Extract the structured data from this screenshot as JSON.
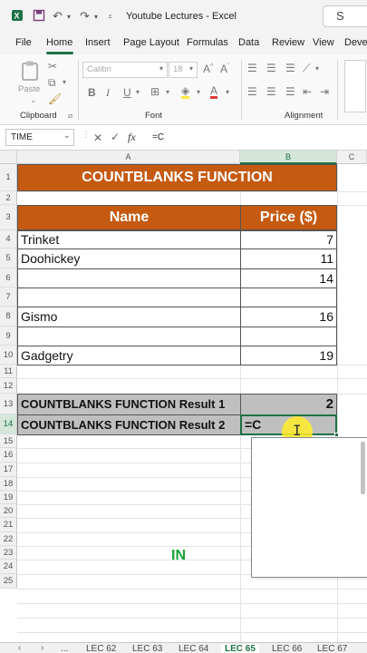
{
  "window": {
    "title": "Youtube Lectures - Excel",
    "search_glyph": "S"
  },
  "menu": {
    "items": [
      "File",
      "Home",
      "Insert",
      "Page Layout",
      "Formulas",
      "Data",
      "Review",
      "View",
      "Devel"
    ],
    "active": "Home"
  },
  "ribbon": {
    "paste_label": "Paste",
    "font_name": "Calibri",
    "font_size": "18",
    "groups": {
      "clipboard": "Clipboard",
      "font": "Font",
      "alignment": "Alignment"
    }
  },
  "formula_bar": {
    "name_box": "TIME",
    "fx_label": "fx",
    "content": "=C"
  },
  "columns": [
    "A",
    "B",
    "C"
  ],
  "active_column": "B",
  "rows": [
    "1",
    "2",
    "3",
    "4",
    "5",
    "6",
    "7",
    "8",
    "9",
    "10",
    "11",
    "12",
    "13",
    "14",
    "15",
    "16",
    "17",
    "18",
    "19",
    "20",
    "21",
    "22",
    "23",
    "24",
    "25"
  ],
  "active_row": "14",
  "sheet": {
    "title": "COUNTBLANKS FUNCTION",
    "headers": {
      "name": "Name",
      "price": "Price ($)"
    },
    "items": [
      {
        "name": "Trinket",
        "price": "7"
      },
      {
        "name": "Doohickey",
        "price": "11"
      },
      {
        "name": "",
        "price": "14"
      },
      {
        "name": "",
        "price": ""
      },
      {
        "name": "Gismo",
        "price": "16"
      },
      {
        "name": "",
        "price": ""
      },
      {
        "name": "Gadgetry",
        "price": "19"
      }
    ],
    "result1_label": "COUNTBLANKS FUNCTION Result 1",
    "result1_value": "2",
    "result2_label": "COUNTBLANKS FUNCTION Result 2",
    "result2_value": "=C"
  },
  "overlay_text": "IN",
  "sheet_tabs": {
    "tabs": [
      "LEC 62",
      "LEC 63",
      "LEC 64",
      "LEC 65",
      "LEC 66",
      "LEC 67"
    ],
    "active": "LEC 65",
    "overflow": "..."
  },
  "colors": {
    "accent": "#1e7145",
    "table_header": "#c55a11",
    "result_fill": "#bfbfbf",
    "cursor_highlight": "#ffec28",
    "overlay_text": "#18a334"
  }
}
